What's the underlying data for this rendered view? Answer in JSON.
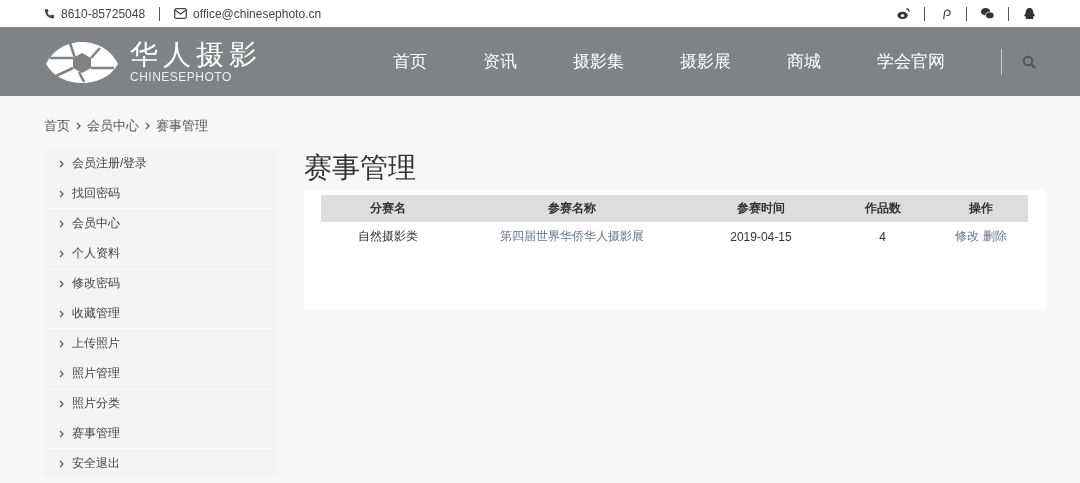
{
  "top_bar": {
    "phone": "8610-85725048",
    "email": "office@chinesephoto.cn"
  },
  "logo": {
    "title": "华人摄影",
    "subtitle": "CHINESEPHOTO"
  },
  "nav": [
    "首页",
    "资讯",
    "摄影集",
    "摄影展",
    "商城",
    "学会官网"
  ],
  "breadcrumb": [
    "首页",
    "会员中心",
    "赛事管理"
  ],
  "sidebar": {
    "items": [
      {
        "label": "会员注册/登录"
      },
      {
        "label": "找回密码"
      },
      {
        "label": "会员中心"
      },
      {
        "label": "个人资料"
      },
      {
        "label": "修改密码"
      },
      {
        "label": "收藏管理"
      },
      {
        "label": "上传照片"
      },
      {
        "label": "照片管理"
      },
      {
        "label": "照片分类"
      },
      {
        "label": "赛事管理"
      },
      {
        "label": "安全退出"
      }
    ]
  },
  "page_title": "赛事管理",
  "table": {
    "columns": [
      "分赛名",
      "参赛名称",
      "参赛时间",
      "作品数",
      "操作"
    ],
    "rows": [
      {
        "category": "自然摄影类",
        "entry": "第四届世界华侨华人摄影展",
        "date": "2019-04-15",
        "count": "4",
        "actions": [
          "修改",
          "删除"
        ]
      }
    ]
  }
}
